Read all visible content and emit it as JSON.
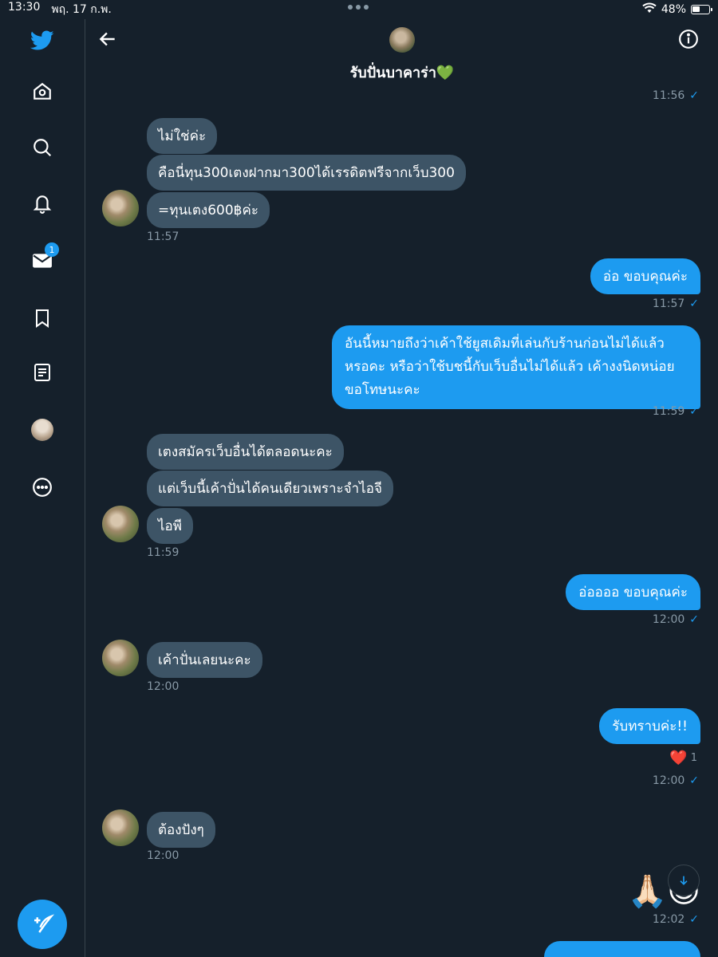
{
  "status_bar": {
    "time": "13:30",
    "date": "พฤ. 17 ก.พ.",
    "battery": "48%"
  },
  "sidebar": {
    "items": [
      {
        "name": "twitter-logo-icon"
      },
      {
        "name": "home-icon"
      },
      {
        "name": "explore-icon"
      },
      {
        "name": "notifications-icon"
      },
      {
        "name": "messages-icon",
        "badge": "1"
      },
      {
        "name": "bookmarks-icon"
      },
      {
        "name": "lists-icon"
      },
      {
        "name": "profile-icon"
      },
      {
        "name": "more-icon"
      }
    ],
    "compose_icon": "compose-tweet-icon"
  },
  "header": {
    "title": "รับปั่นบาคาร่า💚"
  },
  "messages": [
    {
      "id": "m0",
      "dir": "out",
      "time": "11:56"
    },
    {
      "id": "m1",
      "dir": "in",
      "text": "ไม่ใช่ค่ะ"
    },
    {
      "id": "m2",
      "dir": "in",
      "text": "คือนี่ทุน300เตงฝากมา300ได้เรรดิตฟรีจากเว็บ300"
    },
    {
      "id": "m3",
      "dir": "in",
      "text": "=ทุนเตง600฿ค่ะ",
      "time": "11:57"
    },
    {
      "id": "m4",
      "dir": "out",
      "text": "อ่อ ขอบคุณค่ะ",
      "time": "11:57"
    },
    {
      "id": "m5",
      "dir": "out",
      "lines": [
        "อันนี้หมายถึงว่าเค้าใช้ยูสเดิมที่เล่นกับร้านก่อนไม่ได้แล้ว",
        "หรอคะ หรือว่าใช้บชนี้กับเว็บอื่นไม่ได้แล้ว เค้างงนิดหน่อย",
        "ขอโทษนะคะ"
      ],
      "time": "11:59"
    },
    {
      "id": "m6",
      "dir": "in",
      "text": "เตงสมัครเว็บอื่นได้ตลอดนะคะ"
    },
    {
      "id": "m7",
      "dir": "in",
      "text": "แต่เว็บนี้เค้าปั่นได้คนเดียวเพราะจำไอจี"
    },
    {
      "id": "m8",
      "dir": "in",
      "text": "ไอพี",
      "time": "11:59"
    },
    {
      "id": "m9",
      "dir": "out",
      "text": "อ่ออออ ขอบคุณค่ะ",
      "time": "12:00"
    },
    {
      "id": "m10",
      "dir": "in",
      "text": "เค้าปั่นเลยนะคะ",
      "time": "12:00"
    },
    {
      "id": "m11",
      "dir": "out",
      "text": "รับทราบค่ะ!!",
      "time": "12:00",
      "reaction": "❤️",
      "reaction_count": "1"
    },
    {
      "id": "m12",
      "dir": "in",
      "text": "ต้องปังๆ",
      "time": "12:00"
    },
    {
      "id": "m13",
      "dir": "out",
      "emoji": "🙏🏻😇",
      "time": "12:02"
    }
  ],
  "colors": {
    "bg": "#15202b",
    "in_bubble": "#3d5466",
    "out_bubble": "#1d9bf0",
    "muted": "#8899a6"
  }
}
